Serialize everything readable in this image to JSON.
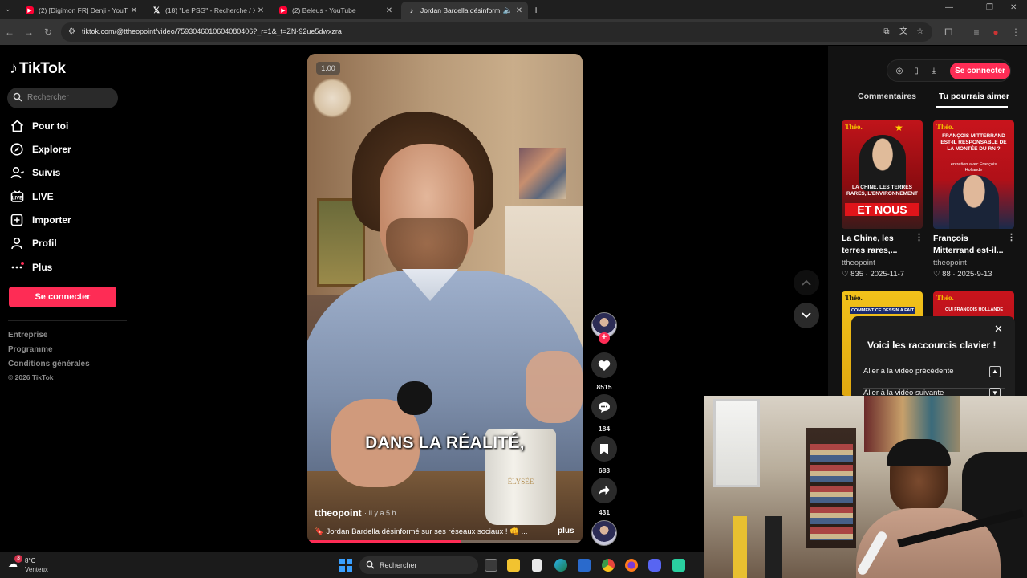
{
  "browser": {
    "tabs": [
      {
        "title": "(2) [Digimon FR] Denji - YouTube",
        "favicon": "youtube-icon"
      },
      {
        "title": "(18) \"Le PSG\" - Recherche / X",
        "favicon": "x-icon"
      },
      {
        "title": "(2) Beleus - YouTube",
        "favicon": "youtube-icon"
      },
      {
        "title": "Jordan Bardella désinform",
        "favicon": "tiktok-icon",
        "active": true
      }
    ],
    "url": "tiktok.com/@ttheopoint/video/7593046010604080406?_r=1&_t=ZN-92ue5dwxzra"
  },
  "tiktok": {
    "brand": "TikTok",
    "search_placeholder": "Rechercher",
    "nav": [
      {
        "label": "Pour toi",
        "icon": "home-icon"
      },
      {
        "label": "Explorer",
        "icon": "compass-icon"
      },
      {
        "label": "Suivis",
        "icon": "user-follow-icon"
      },
      {
        "label": "LIVE",
        "icon": "live-icon"
      },
      {
        "label": "Importer",
        "icon": "upload-icon"
      },
      {
        "label": "Profil",
        "icon": "profile-icon"
      },
      {
        "label": "Plus",
        "icon": "more-icon"
      }
    ],
    "login_label": "Se connecter",
    "footer": [
      "Entreprise",
      "Programme",
      "Conditions générales",
      "© 2026 TikTok"
    ]
  },
  "video": {
    "speed": "1.00",
    "caption": "DANS LA RÉALITÉ,",
    "author": "ttheopoint",
    "time": "· Il y a 5 h",
    "description": "Jordan Bardella désinformé sur ses réseaux sociaux ! 👊 ...",
    "more": "plus",
    "progress": 0.56,
    "actions": {
      "likes": "8515",
      "comments": "184",
      "saves": "683",
      "shares": "431"
    }
  },
  "right_panel": {
    "login_label": "Se connecter",
    "tabs": [
      "Commentaires",
      "Tu pourrais aimer"
    ],
    "cards": [
      {
        "title": "La Chine, les terres rares,...",
        "user": "ttheopoint",
        "likes": "835",
        "date": "2025-11-7",
        "thumb_text": "LA CHINE, LES TERRES RARES, L'ENVIRONNEMENT",
        "thumb_big": "ET NOUS",
        "brand": "Théo."
      },
      {
        "title": "François Mitterrand est-il...",
        "user": "ttheopoint",
        "likes": "88",
        "date": "2025-9-13",
        "thumb_text": "FRANÇOIS MITTERRAND EST-IL RESPONSABLE DE LA MONTÉE DU RN ?",
        "thumb_sub": "entretien avec François Hollande",
        "brand": "Théo."
      },
      {
        "thumb_text": "COMMENT CE DESSIN A FAIT",
        "brand": "Théo."
      },
      {
        "thumb_text": "QUI FRANÇOIS HOLLANDE",
        "brand": "Théo."
      }
    ],
    "shortcuts": {
      "title": "Voici les raccourcis clavier !",
      "rows": [
        "Aller à la vidéo précédente",
        "Aller à la vidéo suivante"
      ]
    }
  },
  "taskbar": {
    "weather_temp": "8°C",
    "weather_desc": "Venteux",
    "weather_badge": "3",
    "search_placeholder": "Rechercher"
  },
  "colors": {
    "accent": "#fe2c55",
    "background": "#000000",
    "panel": "#121212"
  }
}
